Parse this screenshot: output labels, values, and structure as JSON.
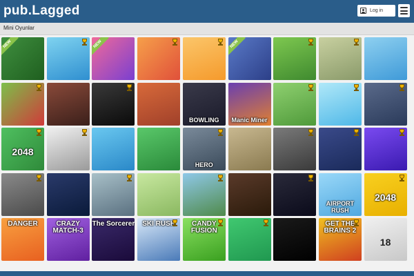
{
  "header": {
    "logo": "pub.Lagged",
    "login_label": "Log in"
  },
  "section": {
    "title": "Mini Oyunlar"
  },
  "colors": {
    "header_bg": "#2a5d8a",
    "page_bg": "#f2f2f2"
  },
  "icons": {
    "trophy": "trophy-icon",
    "menu": "hamburger-menu-icon",
    "user": "user-icon"
  },
  "tiles": [
    {
      "bg": "linear-gradient(135deg,#3f8f3f,#1f5f1f)",
      "caption": "",
      "new": true,
      "trophy": false,
      "name": "pool-game-tile"
    },
    {
      "bg": "linear-gradient(160deg,#7fd3f0,#2f8fd0)",
      "caption": "",
      "new": false,
      "trophy": true,
      "name": "duck-game-tile"
    },
    {
      "bg": "linear-gradient(135deg,#f06a9a,#7a3fd0)",
      "caption": "",
      "new": true,
      "trophy": false,
      "name": "maze-game-tile"
    },
    {
      "bg": "linear-gradient(135deg,#f6a04a,#e0503a)",
      "caption": "",
      "new": false,
      "trophy": true,
      "name": "car-game-tile"
    },
    {
      "bg": "linear-gradient(160deg,#fbc66a,#f59a2c)",
      "caption": "",
      "new": false,
      "trophy": true,
      "name": "yellow-game-tile"
    },
    {
      "bg": "linear-gradient(135deg,#5a7ac8,#2c3f88)",
      "caption": "",
      "new": true,
      "trophy": false,
      "name": "ninja-game-tile"
    },
    {
      "bg": "linear-gradient(160deg,#7ec850,#3f8a2f)",
      "caption": "",
      "new": false,
      "trophy": true,
      "name": "racing-car-game-tile"
    },
    {
      "bg": "linear-gradient(160deg,#c8d0a0,#8a9a6a)",
      "caption": "",
      "new": false,
      "trophy": true,
      "name": "mummy-game-tile"
    },
    {
      "bg": "linear-gradient(160deg,#8ed0f0,#3f9ad8)",
      "caption": "",
      "new": false,
      "trophy": false,
      "name": "soccer-game-tile"
    },
    {
      "bg": "linear-gradient(135deg,#7cc04a,#d03a3a)",
      "caption": "",
      "new": false,
      "trophy": true,
      "name": "fruit-game-tile"
    },
    {
      "bg": "linear-gradient(160deg,#8a4a3a,#3a1f1a)",
      "caption": "",
      "new": false,
      "trophy": false,
      "name": "zombie-game-tile"
    },
    {
      "bg": "linear-gradient(160deg,#3a3a3a,#0a0a0a)",
      "caption": "",
      "new": false,
      "trophy": true,
      "name": "sniper-game-tile"
    },
    {
      "bg": "linear-gradient(160deg,#d86a3a,#a0402a)",
      "caption": "",
      "new": false,
      "trophy": false,
      "name": "track-game-tile"
    },
    {
      "bg": "linear-gradient(160deg,#3a3a4a,#1a1a2a)",
      "caption": "BOWLING",
      "new": false,
      "trophy": false,
      "name": "bowling-game-tile"
    },
    {
      "bg": "linear-gradient(160deg,#6a3fb0,#e08030)",
      "caption": "Manic Miner",
      "new": false,
      "trophy": false,
      "name": "manic-miner-game-tile"
    },
    {
      "bg": "linear-gradient(160deg,#8fd070,#4f9a3a)",
      "caption": "",
      "new": false,
      "trophy": true,
      "name": "bike-game-tile"
    },
    {
      "bg": "linear-gradient(160deg,#b0e8f8,#4fb8e8)",
      "caption": "",
      "new": false,
      "trophy": true,
      "name": "zigzag-game-tile"
    },
    {
      "bg": "linear-gradient(160deg,#5a6a8a,#2a3a5a)",
      "caption": "",
      "new": false,
      "trophy": true,
      "name": "snake-ball-game-tile"
    },
    {
      "bg": "linear-gradient(135deg,#4fc060,#2f8a3a)",
      "caption": "2048",
      "new": false,
      "trophy": true,
      "name": "2048-blocks-game-tile"
    },
    {
      "bg": "linear-gradient(160deg,#f0f0f0,#9a9a9a)",
      "caption": "",
      "new": false,
      "trophy": true,
      "name": "stickman-game-tile"
    },
    {
      "bg": "linear-gradient(160deg,#6ac8f0,#2a88c8)",
      "caption": "",
      "new": false,
      "trophy": false,
      "name": "swimmer-game-tile"
    },
    {
      "bg": "linear-gradient(160deg,#5ac86a,#2a8a3a)",
      "caption": "",
      "new": false,
      "trophy": false,
      "name": "parking-game-tile"
    },
    {
      "bg": "linear-gradient(160deg,#7a8a9a,#3a4a5a)",
      "caption": "HERO",
      "new": false,
      "trophy": true,
      "name": "grand-prix-hero-game-tile"
    },
    {
      "bg": "linear-gradient(160deg,#c8b890,#8a7a50)",
      "caption": "",
      "new": false,
      "trophy": false,
      "name": "tank-game-tile"
    },
    {
      "bg": "linear-gradient(160deg,#7a7a7a,#3a3a3a)",
      "caption": "",
      "new": false,
      "trophy": true,
      "name": "taxi-game-tile"
    },
    {
      "bg": "linear-gradient(160deg,#3a4a8a,#1a2a5a)",
      "caption": "",
      "new": false,
      "trophy": true,
      "name": "boxing-game-tile"
    },
    {
      "bg": "linear-gradient(160deg,#7a4af0,#3a1ab0)",
      "caption": "",
      "new": false,
      "trophy": true,
      "name": "square-run-game-tile"
    },
    {
      "bg": "linear-gradient(160deg,#8a8a8a,#4a4a4a)",
      "caption": "",
      "new": false,
      "trophy": true,
      "name": "traffic-game-tile"
    },
    {
      "bg": "linear-gradient(160deg,#2a3a6a,#0a1a3a)",
      "caption": "",
      "new": false,
      "trophy": false,
      "name": "space-shooter-game-tile"
    },
    {
      "bg": "linear-gradient(160deg,#a8c0c8,#5a7080)",
      "caption": "",
      "new": false,
      "trophy": true,
      "name": "warship-game-tile"
    },
    {
      "bg": "linear-gradient(160deg,#c8e8a0,#8ab860)",
      "caption": "",
      "new": false,
      "trophy": false,
      "name": "offroad-game-tile"
    },
    {
      "bg": "linear-gradient(160deg,#8fc8e8,#4f8a4a)",
      "caption": "",
      "new": false,
      "trophy": true,
      "name": "shooter-game-tile"
    },
    {
      "bg": "linear-gradient(160deg,#5a3a2a,#2a1a0a)",
      "caption": "",
      "new": false,
      "trophy": false,
      "name": "slot-game-tile"
    },
    {
      "bg": "linear-gradient(160deg,#2a2a3a,#0a0a1a)",
      "caption": "",
      "new": false,
      "trophy": true,
      "name": "number-grid-game-tile"
    },
    {
      "bg": "linear-gradient(160deg,#9ad8f8,#4fa8e0)",
      "caption": "AIRPORT RUSH",
      "new": false,
      "trophy": false,
      "name": "airport-rush-game-tile"
    },
    {
      "bg": "linear-gradient(160deg,#f8d020,#e8b000)",
      "caption": "2048",
      "new": false,
      "trophy": true,
      "name": "2048-game-tile"
    },
    {
      "bg": "linear-gradient(160deg,#f8a040,#e86020)",
      "caption": "",
      "top": "DANGER",
      "new": false,
      "trophy": false,
      "name": "danger-game-tile"
    },
    {
      "bg": "linear-gradient(160deg,#a060e0,#6020a0)",
      "caption": "",
      "top": "CRAZY MATCH-3",
      "new": false,
      "trophy": false,
      "name": "crazy-match-3-game-tile"
    },
    {
      "bg": "linear-gradient(160deg,#3a2a6a,#1a0a3a)",
      "caption": "",
      "top": "The Sorcerer",
      "new": false,
      "trophy": false,
      "name": "sorcerer-game-tile"
    },
    {
      "bg": "linear-gradient(160deg,#d8e8f8,#4a7ab8)",
      "caption": "",
      "top": "SKI RUSH",
      "new": false,
      "trophy": true,
      "name": "ski-rush-game-tile"
    },
    {
      "bg": "linear-gradient(160deg,#8ae060,#3aa020)",
      "caption": "",
      "top": "CANDY FUSION",
      "new": false,
      "trophy": true,
      "name": "candy-fusion-game-tile"
    },
    {
      "bg": "linear-gradient(160deg,#40c870,#209850)",
      "caption": "",
      "new": false,
      "trophy": true,
      "name": "tap-game-tile"
    },
    {
      "bg": "linear-gradient(160deg,#1a1a1a,#000000)",
      "caption": "",
      "new": false,
      "trophy": false,
      "name": "tangram-game-tile"
    },
    {
      "bg": "linear-gradient(160deg,#f0c020,#d04020)",
      "caption": "",
      "top": "GET THE BRAINS 2",
      "new": false,
      "trophy": true,
      "name": "get-the-brains-2-game-tile"
    },
    {
      "bg": "linear-gradient(160deg,#f0f0f0,#c8c8c8)",
      "caption": "18",
      "new": false,
      "trophy": false,
      "name": "hexa-18-game-tile"
    }
  ]
}
